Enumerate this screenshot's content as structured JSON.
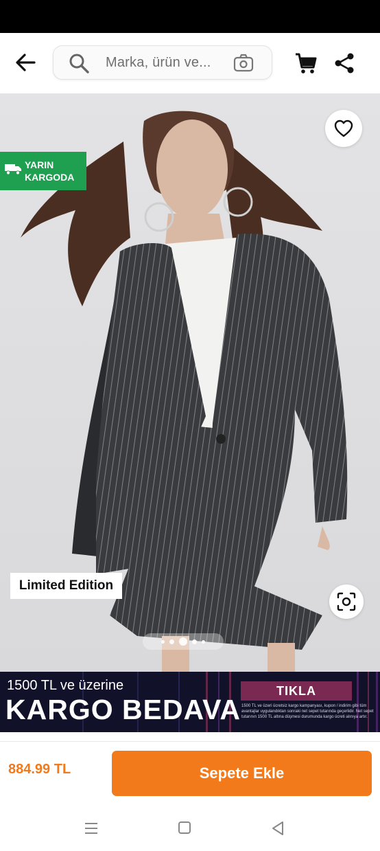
{
  "search": {
    "placeholder": "Marka, ürün ve..."
  },
  "icons": {
    "back": "arrow-left-icon",
    "search": "search-icon",
    "camera": "camera-search-icon",
    "cart": "cart-icon",
    "share": "share-icon",
    "favorite": "heart-icon",
    "truck": "truck-icon",
    "lens": "visual-search-icon"
  },
  "product": {
    "image_alt": "Model wearing pinstripe blazer and pleated mini skirt",
    "badge": {
      "line1": "YARIN",
      "line2": "KARGODA"
    },
    "limited_label": "Limited Edition",
    "gallery": {
      "count": 5,
      "active_index": 2
    },
    "price": "884.99 TL"
  },
  "banner": {
    "line1": "1500 TL ve üzerine",
    "line2": "KARGO BEDAVA",
    "cta": "TIKLA",
    "fine_print": "1500 TL ve üzeri ücretsiz kargo kampanyası, kupon / indirim gibi tüm avantajlar uygulandıktan sonraki net sepet tutarında geçerlidir. Net sepet tutarının 1500 TL altına düşmesi durumunda kargo ücreti alınıya artır."
  },
  "actions": {
    "add_to_cart": "Sepete Ekle"
  },
  "colors": {
    "accent": "#f27a1a",
    "badge_green": "#1ea050",
    "banner_bg": "#11112a",
    "cta_bg": "#7a2a52"
  }
}
